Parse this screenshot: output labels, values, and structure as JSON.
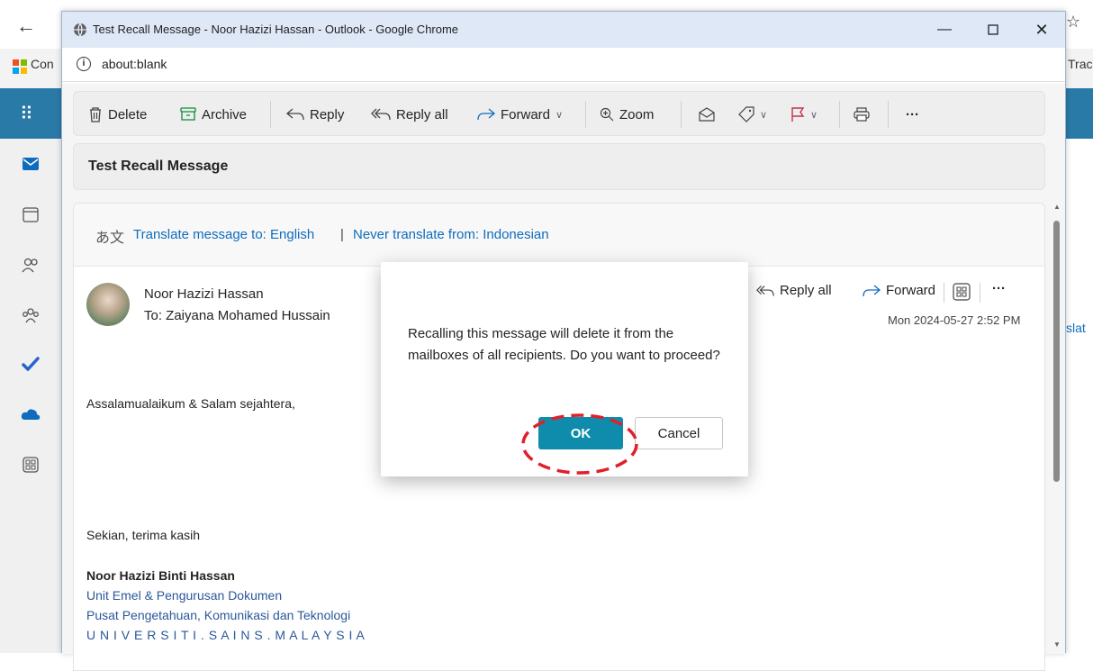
{
  "browser_bg": {
    "bookmark_1": "Con",
    "bookmark_2": "Trac",
    "partial_text": "slat"
  },
  "window": {
    "title": "Test Recall Message - Noor Hazizi Hassan - Outlook - Google Chrome",
    "url": "about:blank",
    "minimize_icon": "minimize-icon",
    "maximize_icon": "maximize-icon",
    "close_icon": "close-icon"
  },
  "toolbar": {
    "delete": "Delete",
    "archive": "Archive",
    "reply": "Reply",
    "reply_all": "Reply all",
    "forward": "Forward",
    "zoom": "Zoom",
    "more": "···"
  },
  "subject": "Test Recall Message",
  "translate": {
    "translate_to": "Translate message to: English",
    "separator": "|",
    "never_translate": "Never translate from: Indonesian"
  },
  "message": {
    "from": "Noor Hazizi Hassan",
    "to": "To:  Zaiyana Mohamed Hussain",
    "reply_all": "Reply all",
    "forward": "Forward",
    "more": "···",
    "date": "Mon 2024-05-27 2:52 PM",
    "greeting": "Assalamualaikum & Salam sejahtera,",
    "closing": "Sekian, terima kasih",
    "sig_name": "Noor Hazizi Binti Hassan",
    "sig_unit": "Unit Emel & Pengurusan Dokumen",
    "sig_center": "Pusat Pengetahuan, Komunikasi dan Teknologi",
    "sig_uni": "U N I V E R S I T I . S A I N S . M A L A Y S I A"
  },
  "dialog": {
    "text": "Recalling this message will delete it from the mailboxes of all recipients. Do you want to proceed?",
    "ok": "OK",
    "cancel": "Cancel"
  },
  "colors": {
    "accent": "#0f8cab",
    "link": "#0f6cbd",
    "annotation": "#e0202a"
  }
}
